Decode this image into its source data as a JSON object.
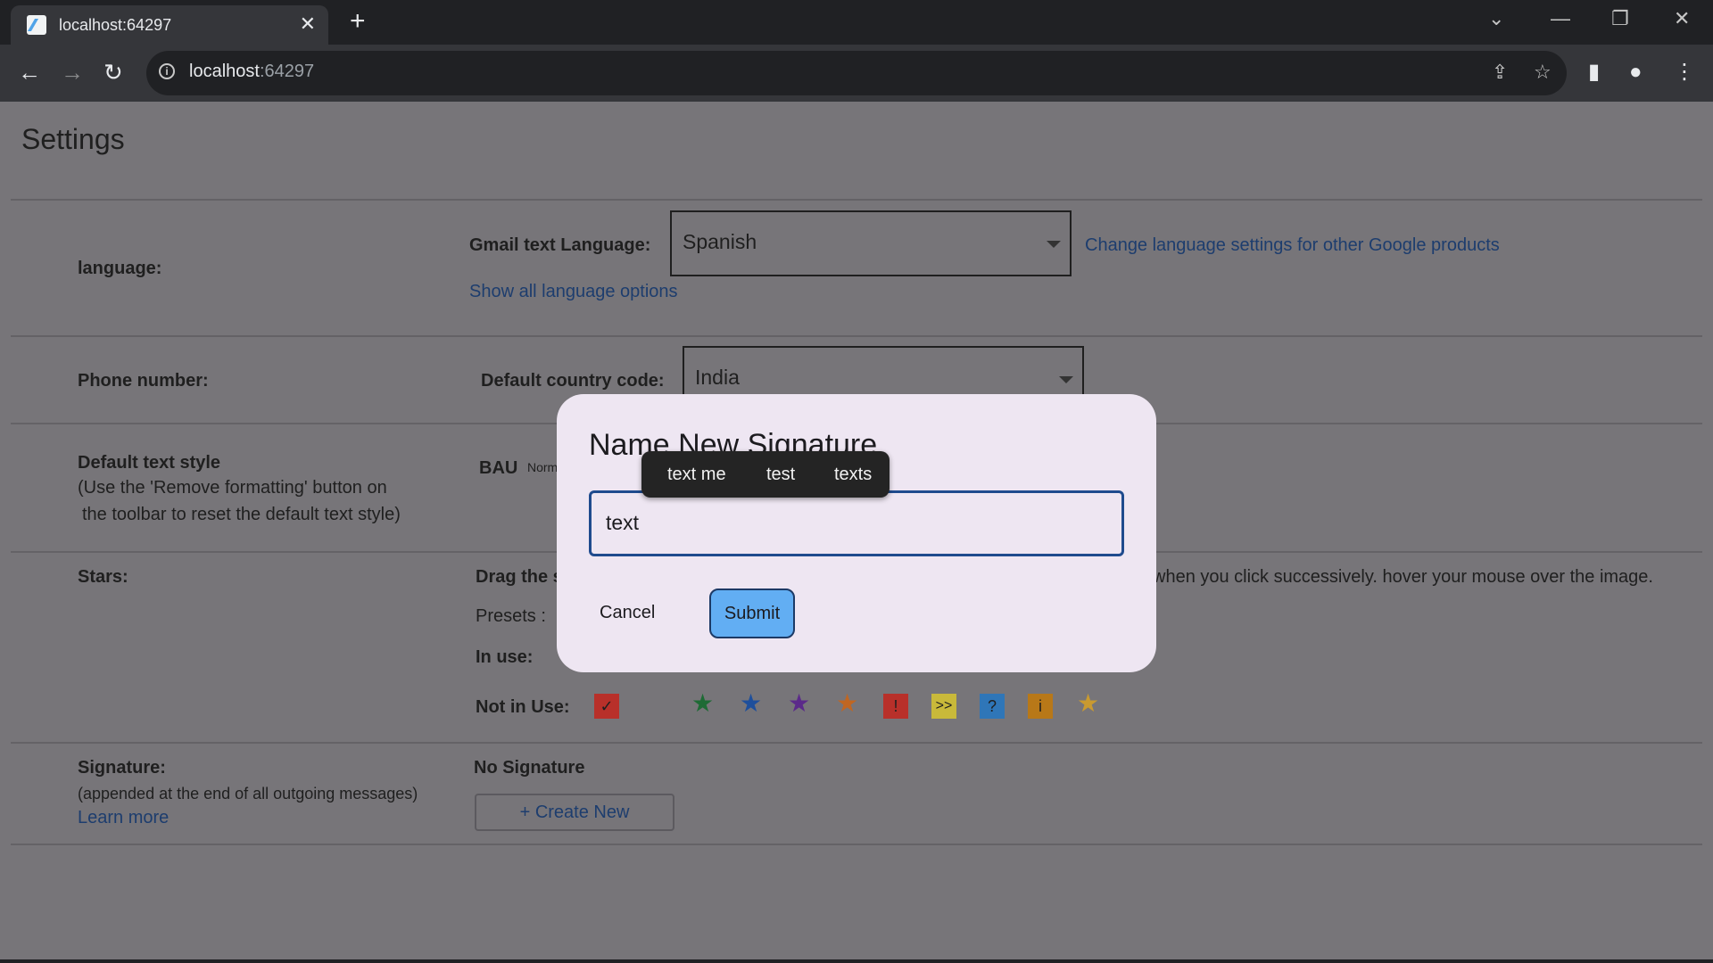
{
  "browser": {
    "tab_title": "localhost:64297",
    "url_host": "localhost",
    "url_port": ":64297",
    "tab_close": "✕",
    "new_tab": "+",
    "win_dropdown": "⌄",
    "win_min": "—",
    "win_restore": "❐",
    "win_close": "✕",
    "back": "←",
    "forward": "→",
    "reload": "↻",
    "info": "i",
    "share": "⇪",
    "bookmark": "☆",
    "sidepanel": "▮",
    "profile": "●",
    "menu": "⋮"
  },
  "page": {
    "title": "Settings",
    "language": {
      "label": "language:",
      "field_label": "Gmail text Language:",
      "selected": "Spanish",
      "other_link": "Change language settings for other Google products",
      "show_all": "Show all language options"
    },
    "phone": {
      "label": "Phone number:",
      "field_label": "Default country code:",
      "selected": "India"
    },
    "text_style": {
      "label": "Default text style",
      "note1": "(Use the 'Remove formatting' button on",
      "note2": "the toolbar to reset the default text style)",
      "font": "BAU",
      "size": "Norm"
    },
    "stars": {
      "label": "Stars:",
      "drag_text": "Drag the s",
      "drag_text_end": "when you click successively. hover your mouse over the image.",
      "presets_label": "Presets :",
      "in_use_label": "In use:",
      "not_in_use_label": "Not in Use:",
      "icons": {
        "check": "✓",
        "star": "★",
        "bang": "!",
        "arrows": ">>",
        "question": "?",
        "info": "i"
      },
      "colors": {
        "green": "#1e6b35",
        "blue": "#1e4f9c",
        "purple": "#5b2a8a",
        "orange": "#c06622",
        "red": "#b8302a",
        "yellow": "#c9b93a",
        "teal": "#2f76b8",
        "amber": "#b87818",
        "gold": "#c99a30"
      }
    },
    "signature": {
      "label": "Signature:",
      "note": "(appended at the end of all outgoing messages)",
      "learn_more": "Learn more",
      "status": "No Signature",
      "create_new": "+ Create New"
    }
  },
  "dialog": {
    "title": "Name New Signature",
    "input_value": "text",
    "cancel": "Cancel",
    "submit": "Submit",
    "suggestions": [
      "text me",
      "test",
      "texts"
    ]
  }
}
